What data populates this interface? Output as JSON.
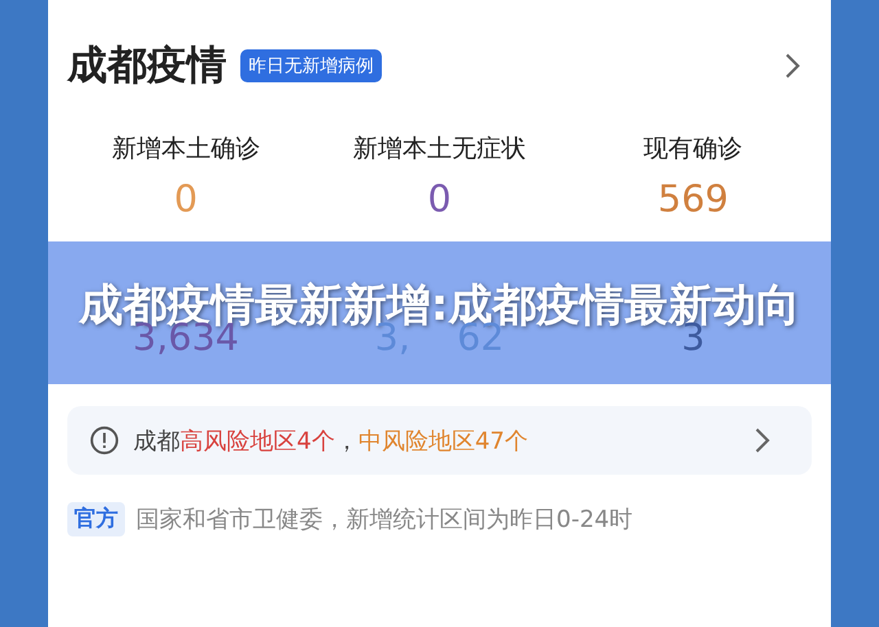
{
  "header": {
    "title": "成都疫情",
    "badge": "昨日无新增病例"
  },
  "stats_top": [
    {
      "label": "新增本土确诊",
      "value": "0",
      "color": "#e39a55"
    },
    {
      "label": "新增本土无症状",
      "value": "0",
      "color": "#7b5bb0"
    },
    {
      "label": "现有确诊",
      "value": "569",
      "color": "#d0803f"
    }
  ],
  "stats_bottom": [
    {
      "value": "3,634",
      "color": "#6a58a8"
    },
    {
      "value_start": "3,",
      "value_end": "62",
      "color": "#5d8ad8"
    },
    {
      "value": "3",
      "color": "#3d5a9e"
    }
  ],
  "risk_notice": {
    "city": "成都",
    "high": "高风险地区4个",
    "separator": "，",
    "medium": "中风险地区47个"
  },
  "source": {
    "tag": "官方",
    "text": "国家和省市卫健委，新增统计区间为昨日0-24时"
  },
  "banner": {
    "title": "成都疫情最新新增:成都疫情最新动向"
  }
}
